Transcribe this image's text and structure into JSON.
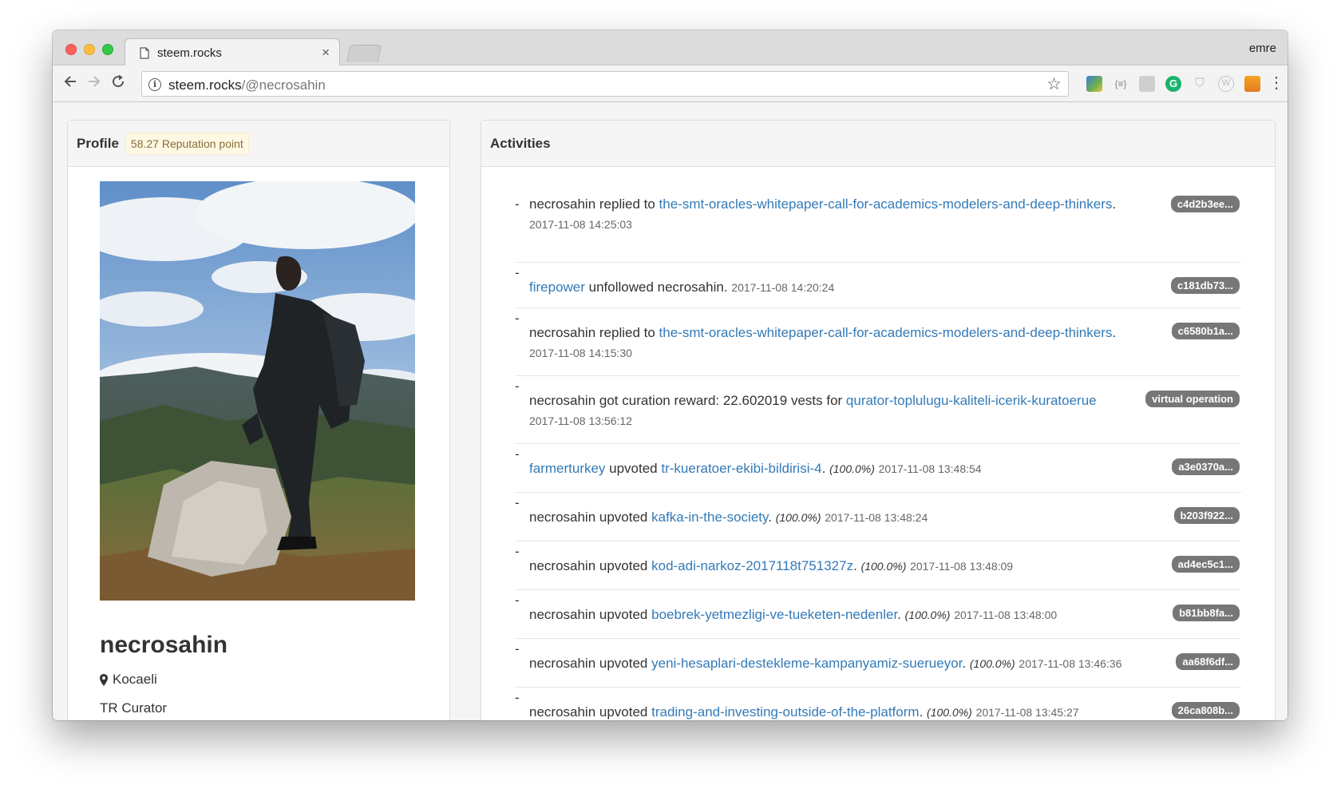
{
  "browser": {
    "tab_title": "steem.rocks",
    "user": "emre",
    "url_host": "steem.rocks",
    "url_path": "/@necrosahin"
  },
  "profile": {
    "header": "Profile",
    "reputation": "58.27 Reputation point",
    "name": "necrosahin",
    "location": "Kocaeli",
    "bio": "TR Curator"
  },
  "activities": {
    "header": "Activities",
    "items": [
      {
        "pre": "necrosahin replied to ",
        "link": "the-smt-oracles-whitepaper-call-for-academics-modelers-and-deep-thinkers",
        "post": ".",
        "pct": "",
        "time": "2017-11-08 14:25:03",
        "badge": "c4d2b3ee..."
      },
      {
        "pre": "",
        "link": "firepower",
        "post": " unfollowed necrosahin.",
        "pct": "",
        "time": "2017-11-08 14:20:24",
        "badge": "c181db73..."
      },
      {
        "pre": "necrosahin replied to ",
        "link": "the-smt-oracles-whitepaper-call-for-academics-modelers-and-deep-thinkers",
        "post": ".",
        "pct": "",
        "time": "2017-11-08 14:15:30",
        "badge": "c6580b1a..."
      },
      {
        "pre": "necrosahin got curation reward: 22.602019 vests for ",
        "link": "qurator-toplulugu-kaliteli-icerik-kuratoerue",
        "post": "",
        "pct": "",
        "time": "2017-11-08 13:56:12",
        "badge": "virtual operation"
      },
      {
        "pre": "",
        "link": "farmerturkey",
        "post": " upvoted ",
        "link2": "tr-kueratoer-ekibi-bildirisi-4",
        "post2": ".",
        "pct": "(100.0%)",
        "time": "2017-11-08 13:48:54",
        "badge": "a3e0370a..."
      },
      {
        "pre": "necrosahin upvoted ",
        "link": "kafka-in-the-society",
        "post": ".",
        "pct": "(100.0%)",
        "time": "2017-11-08 13:48:24",
        "badge": "b203f922..."
      },
      {
        "pre": "necrosahin upvoted ",
        "link": "kod-adi-narkoz-2017118t751327z",
        "post": ".",
        "pct": "(100.0%)",
        "time": "2017-11-08 13:48:09",
        "badge": "ad4ec5c1..."
      },
      {
        "pre": "necrosahin upvoted ",
        "link": "boebrek-yetmezligi-ve-tueketen-nedenler",
        "post": ".",
        "pct": "(100.0%)",
        "time": "2017-11-08 13:48:00",
        "badge": "b81bb8fa..."
      },
      {
        "pre": "necrosahin upvoted ",
        "link": "yeni-hesaplari-destekleme-kampanyamiz-sueruеyor",
        "post": ".",
        "pct": "(100.0%)",
        "time": "2017-11-08 13:46:36",
        "badge": "aa68f6df..."
      },
      {
        "pre": "necrosahin upvoted ",
        "link": "trading-and-investing-outside-of-the-platform",
        "post": ".",
        "pct": "(100.0%)",
        "time": "2017-11-08 13:45:27",
        "badge": "26ca808b..."
      }
    ]
  },
  "icons": {
    "back": "arrow-left-icon",
    "forward": "arrow-right-icon",
    "reload": "reload-icon",
    "info": "info-icon",
    "bookmark": "star-icon",
    "menu": "kebab-menu-icon",
    "location": "map-marker-icon"
  }
}
